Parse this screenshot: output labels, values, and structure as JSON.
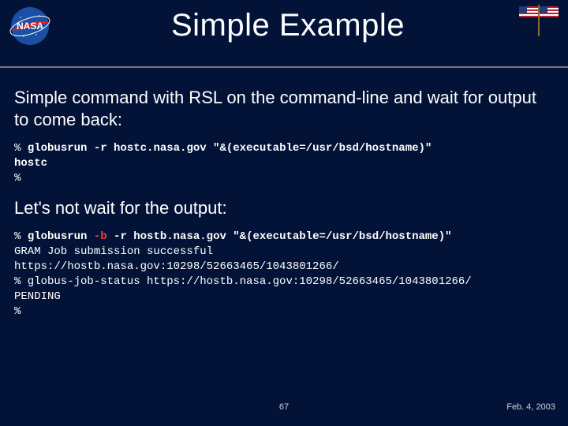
{
  "header": {
    "title": "Simple Example"
  },
  "body": {
    "para1": "Simple command with RSL on the command-line and wait for output to come back:",
    "code1": {
      "l1a": "% ",
      "l1b": "globusrun -r hostc.nasa.gov \"&(executable=/usr/bsd/hostname)\"",
      "l2": "hostc",
      "l3": "%"
    },
    "para2": "Let's not wait for the output:",
    "code2": {
      "l1a": "% ",
      "l1b": "globusrun ",
      "l1c": "-b",
      "l1d": " -r hostb.nasa.gov \"&(executable=/usr/bsd/hostname)\"",
      "l2": "GRAM Job submission successful",
      "l3": "https://hostb.nasa.gov:10298/52663465/1043801266/",
      "l4": "% globus-job-status https://hostb.nasa.gov:10298/52663465/1043801266/",
      "l5": "PENDING",
      "l6": "%"
    }
  },
  "footer": {
    "page": "67",
    "date": "Feb. 4, 2003"
  },
  "logos": {
    "left": "nasa-logo",
    "right": "us-flag"
  }
}
